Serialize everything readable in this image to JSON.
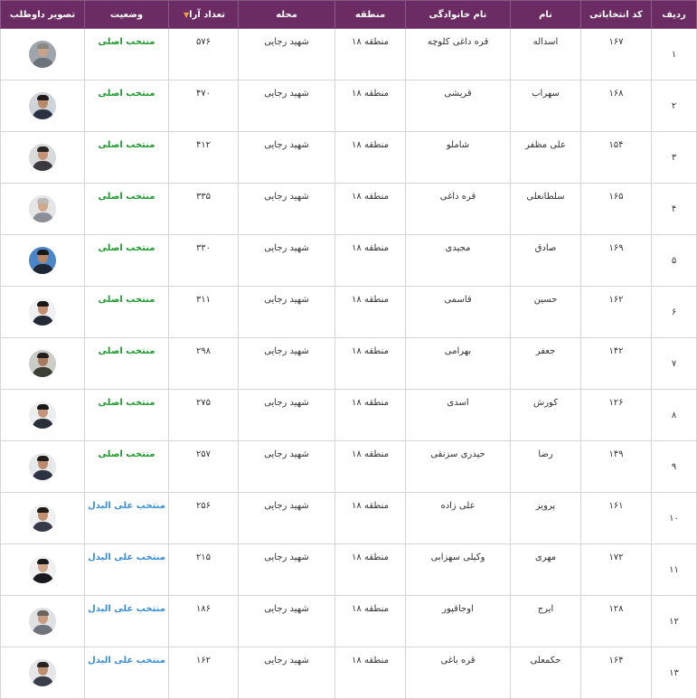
{
  "headers": {
    "row": "ردیف",
    "code": "کد انتخاباتی",
    "first_name": "نام",
    "last_name": "نام خانوادگی",
    "district": "منطقه",
    "neighborhood": "محله",
    "votes": "تعداد آرا",
    "status": "وضعیت",
    "photo": "تصویر داوطلب"
  },
  "sort_icon": "sort-down-triangle-icon",
  "colors": {
    "header_bg": "#6b2c64",
    "status_main": "#1e9a2e",
    "status_alt": "#3a8fd6",
    "sort_icon": "#f0a030"
  },
  "rows": [
    {
      "row": "۱",
      "code": "۱۶۷",
      "first_name": "اسداله",
      "last_name": "قره داغی کلوچه",
      "district": "منطقه ۱۸",
      "neighborhood": "شهید رجایی",
      "votes": "۵۷۶",
      "status": "منتخب اصلی",
      "status_type": "main",
      "photo": "candidate-photo-icon",
      "bg": "#9ea5ad",
      "shirt": "#6c717a",
      "hair": "#8a8680",
      "skin": "#c9a389"
    },
    {
      "row": "۲",
      "code": "۱۶۸",
      "first_name": "سهراب",
      "last_name": "قریشی",
      "district": "منطقه ۱۸",
      "neighborhood": "شهید رجایی",
      "votes": "۴۷۰",
      "status": "منتخب اصلی",
      "status_type": "main",
      "photo": "candidate-photo-icon",
      "bg": "#cfd4d8",
      "shirt": "#2b3140",
      "hair": "#1e1a18",
      "skin": "#b98a6a"
    },
    {
      "row": "۳",
      "code": "۱۵۴",
      "first_name": "علی مظفر",
      "last_name": "شاملو",
      "district": "منطقه ۱۸",
      "neighborhood": "شهید رجایی",
      "votes": "۴۱۲",
      "status": "منتخب اصلی",
      "status_type": "main",
      "photo": "candidate-photo-icon",
      "bg": "#d8dadc",
      "shirt": "#3c3a40",
      "hair": "#2a2624",
      "skin": "#c49478"
    },
    {
      "row": "۴",
      "code": "۱۶۵",
      "first_name": "سلطانعلی",
      "last_name": "قره داغی",
      "district": "منطقه ۱۸",
      "neighborhood": "شهید رجایی",
      "votes": "۳۳۵",
      "status": "منتخب اصلی",
      "status_type": "main",
      "photo": "candidate-photo-icon",
      "bg": "#e3e5e7",
      "shirt": "#8a8f98",
      "hair": "#bdbab4",
      "skin": "#d0a88c"
    },
    {
      "row": "۵",
      "code": "۱۶۹",
      "first_name": "صادق",
      "last_name": "مجیدی",
      "district": "منطقه ۱۸",
      "neighborhood": "شهید رجایی",
      "votes": "۳۳۰",
      "status": "منتخب اصلی",
      "status_type": "main",
      "photo": "candidate-photo-icon",
      "bg": "#4a86c8",
      "shirt": "#1f2633",
      "hair": "#1a1716",
      "skin": "#b88566"
    },
    {
      "row": "۶",
      "code": "۱۶۲",
      "first_name": "حسین",
      "last_name": "قاسمی",
      "district": "منطقه ۱۸",
      "neighborhood": "شهید رجایی",
      "votes": "۳۱۱",
      "status": "منتخب اصلی",
      "status_type": "main",
      "photo": "candidate-photo-icon",
      "bg": "#eef0f2",
      "shirt": "#242a36",
      "hair": "#1c1816",
      "skin": "#c29070"
    },
    {
      "row": "۷",
      "code": "۱۴۲",
      "first_name": "جعفر",
      "last_name": "بهرامی",
      "district": "منطقه ۱۸",
      "neighborhood": "شهید رجایی",
      "votes": "۲۹۸",
      "status": "منتخب اصلی",
      "status_type": "main",
      "photo": "candidate-photo-icon",
      "bg": "#c9cdc6",
      "shirt": "#3a4032",
      "hair": "#221e1b",
      "skin": "#a87a5e"
    },
    {
      "row": "۸",
      "code": "۱۲۶",
      "first_name": "کورش",
      "last_name": "اسدی",
      "district": "منطقه ۱۸",
      "neighborhood": "شهید رجایی",
      "votes": "۲۷۵",
      "status": "منتخب اصلی",
      "status_type": "main",
      "photo": "candidate-photo-icon",
      "bg": "#eceeef",
      "shirt": "#2a2f3b",
      "hair": "#1b1816",
      "skin": "#c4957a"
    },
    {
      "row": "۹",
      "code": "۱۴۹",
      "first_name": "رضا",
      "last_name": "حیدری سزنقی",
      "district": "منطقه ۱۸",
      "neighborhood": "شهید رجایی",
      "votes": "۲۵۷",
      "status": "منتخب اصلی",
      "status_type": "main",
      "photo": "candidate-photo-icon",
      "bg": "#e6e8ea",
      "shirt": "#2d3340",
      "hair": "#201c1a",
      "skin": "#bd8c6e"
    },
    {
      "row": "۱۰",
      "code": "۱۶۱",
      "first_name": "پرویز",
      "last_name": "علی زاده",
      "district": "منطقه ۱۸",
      "neighborhood": "شهید رجایی",
      "votes": "۲۵۶",
      "status": "منتخب علی البدل",
      "status_type": "alt",
      "photo": "candidate-photo-icon",
      "bg": "#eef0f2",
      "shirt": "#353a46",
      "hair": "#1e1a18",
      "skin": "#c0906f"
    },
    {
      "row": "۱۱",
      "code": "۱۷۲",
      "first_name": "مهری",
      "last_name": "وکیلی سهزابی",
      "district": "منطقه ۱۸",
      "neighborhood": "شهید رجایی",
      "votes": "۲۱۵",
      "status": "منتخب علی البدل",
      "status_type": "alt",
      "photo": "candidate-photo-icon",
      "bg": "#f0f0f0",
      "shirt": "#1a1a1e",
      "hair": "#1a1a1e",
      "skin": "#d2a88c"
    },
    {
      "row": "۱۲",
      "code": "۱۲۸",
      "first_name": "ایرج",
      "last_name": "اوجاقپور",
      "district": "منطقه ۱۸",
      "neighborhood": "شهید رجایی",
      "votes": "۱۸۶",
      "status": "منتخب علی البدل",
      "status_type": "alt",
      "photo": "candidate-photo-icon",
      "bg": "#dfe2e5",
      "shirt": "#6e737c",
      "hair": "#6a6460",
      "skin": "#c79c80"
    },
    {
      "row": "۱۳",
      "code": "۱۶۴",
      "first_name": "حکمعلی",
      "last_name": "قره باغی",
      "district": "منطقه ۱۸",
      "neighborhood": "شهید رجایی",
      "votes": "۱۶۲",
      "status": "منتخب علی البدل",
      "status_type": "alt",
      "photo": "candidate-photo-icon",
      "bg": "#e4e6e8",
      "shirt": "#3a3f4a",
      "hair": "#2a2522",
      "skin": "#bf8e70"
    }
  ]
}
